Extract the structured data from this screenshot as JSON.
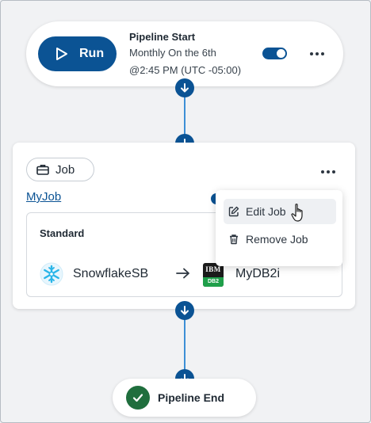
{
  "pipeline_start": {
    "run_label": "Run",
    "title": "Pipeline Start",
    "schedule_line1": "Monthly On the 6th",
    "schedule_line2": "@2:45 PM (UTC -05:00)",
    "enabled": true
  },
  "job": {
    "type_label": "Job",
    "name": "MyJob",
    "mode": "Standard",
    "source": "SnowflakeSB",
    "destination": "MyDB2i",
    "destination_icon_text": "IBM",
    "destination_icon_badge": "DB2"
  },
  "context_menu": {
    "items": [
      {
        "label": "Edit Job",
        "icon": "pencil-square-icon",
        "hovered": true
      },
      {
        "label": "Remove Job",
        "icon": "trash-icon",
        "hovered": false
      }
    ]
  },
  "pipeline_end": {
    "label": "Pipeline End"
  },
  "colors": {
    "primary": "#0b5394",
    "connector": "#3d8fd6",
    "success": "#1f6e3d",
    "snowflake": "#29b5e8",
    "db2_green": "#1f9f4a"
  }
}
